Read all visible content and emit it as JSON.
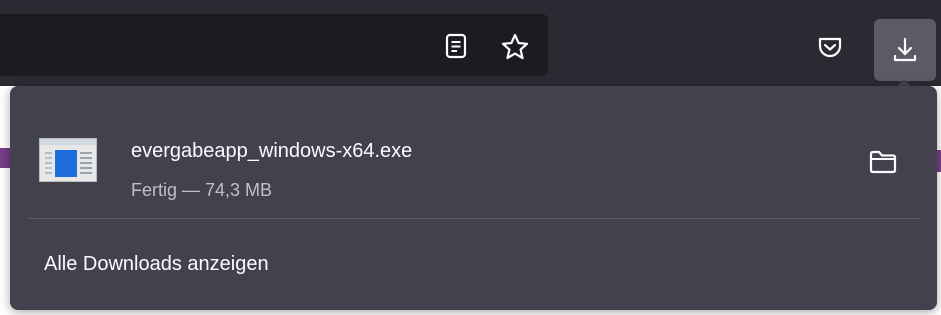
{
  "toolbar": {
    "icons": {
      "reader": "reader-view-icon",
      "bookmark": "bookmark-star-icon",
      "pocket": "pocket-icon",
      "downloads": "downloads-arrow-icon"
    }
  },
  "downloads_panel": {
    "items": [
      {
        "filename": "evergabeapp_windows-x64.exe",
        "status": "Fertig — 74,3 MB",
        "icon": "exe-file-icon",
        "action_icon": "open-folder-icon"
      }
    ],
    "show_all_label": "Alle Downloads anzeigen"
  },
  "colors": {
    "toolbar_bg": "#2b2a33",
    "urlbar_bg": "#1c1b22",
    "panel_bg": "#42414d",
    "text_primary": "#fbfbfe",
    "text_secondary": "#bfbfc9",
    "download_button_bg": "#5b5b66",
    "file_icon_accent": "#1e6fd9"
  }
}
